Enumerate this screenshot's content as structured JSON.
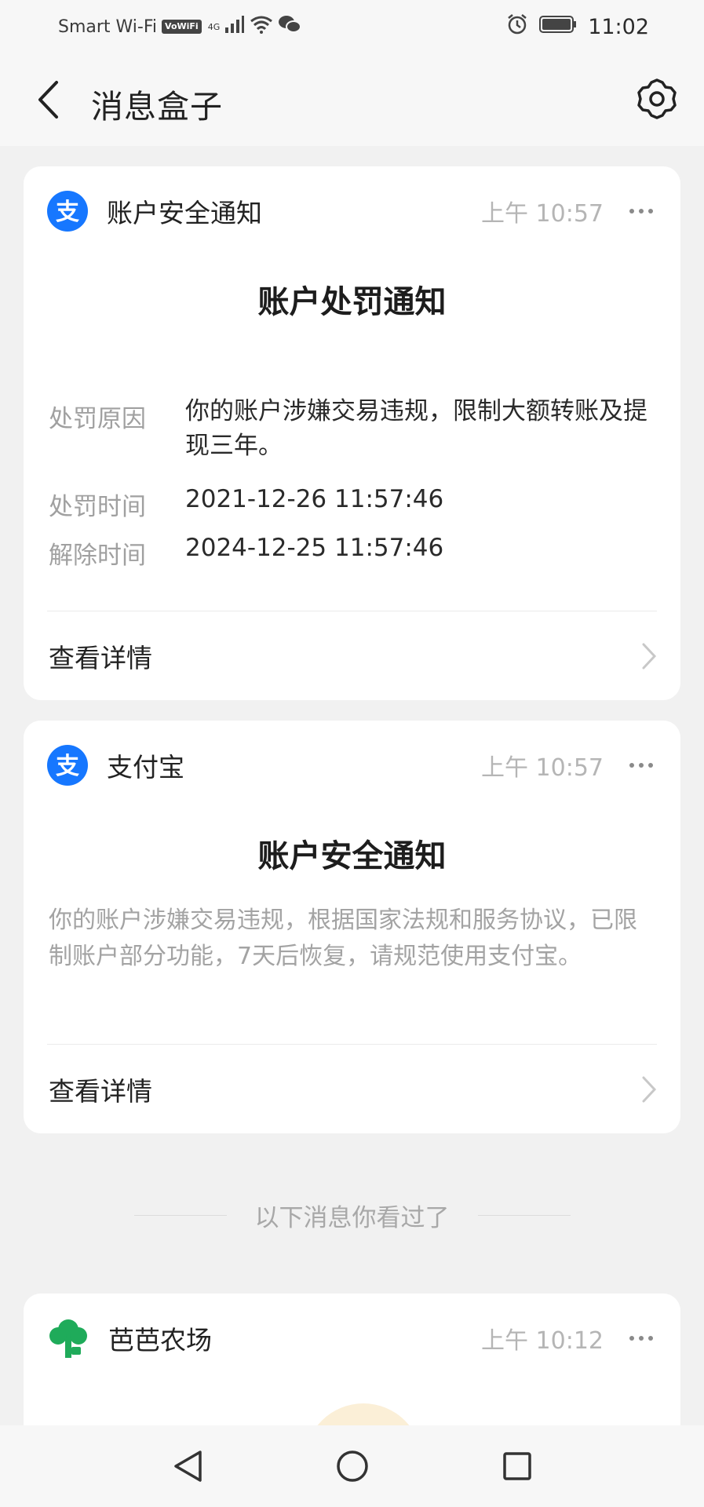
{
  "status_bar": {
    "carrier": "Smart Wi-Fi",
    "volte": "VoWiFi",
    "network": "4G",
    "time": "11:02"
  },
  "header": {
    "title": "消息盒子"
  },
  "cards": [
    {
      "app_name": "账户安全通知",
      "time": "上午 10:57",
      "title": "账户处罚通知",
      "rows": [
        {
          "label": "处罚原因",
          "value": "你的账户涉嫌交易违规，限制大额转账及提现三年。"
        },
        {
          "label": "处罚时间",
          "value": "2021-12-26 11:57:46"
        },
        {
          "label": "解除时间",
          "value": "2024-12-25 11:57:46"
        }
      ],
      "link_label": "查看详情"
    },
    {
      "app_name": "支付宝",
      "time": "上午 10:57",
      "title": "账户安全通知",
      "body": "你的账户涉嫌交易违规，根据国家法规和服务协议，已限制账户部分功能，7天后恢复，请规范使用支付宝。",
      "link_label": "查看详情"
    },
    {
      "app_name": "芭芭农场",
      "time": "上午 10:12"
    }
  ],
  "seen_separator": "以下消息你看过了",
  "colors": {
    "alipay_blue": "#1677ff",
    "farm_green": "#1fab5a",
    "background": "#f1f1f1"
  }
}
